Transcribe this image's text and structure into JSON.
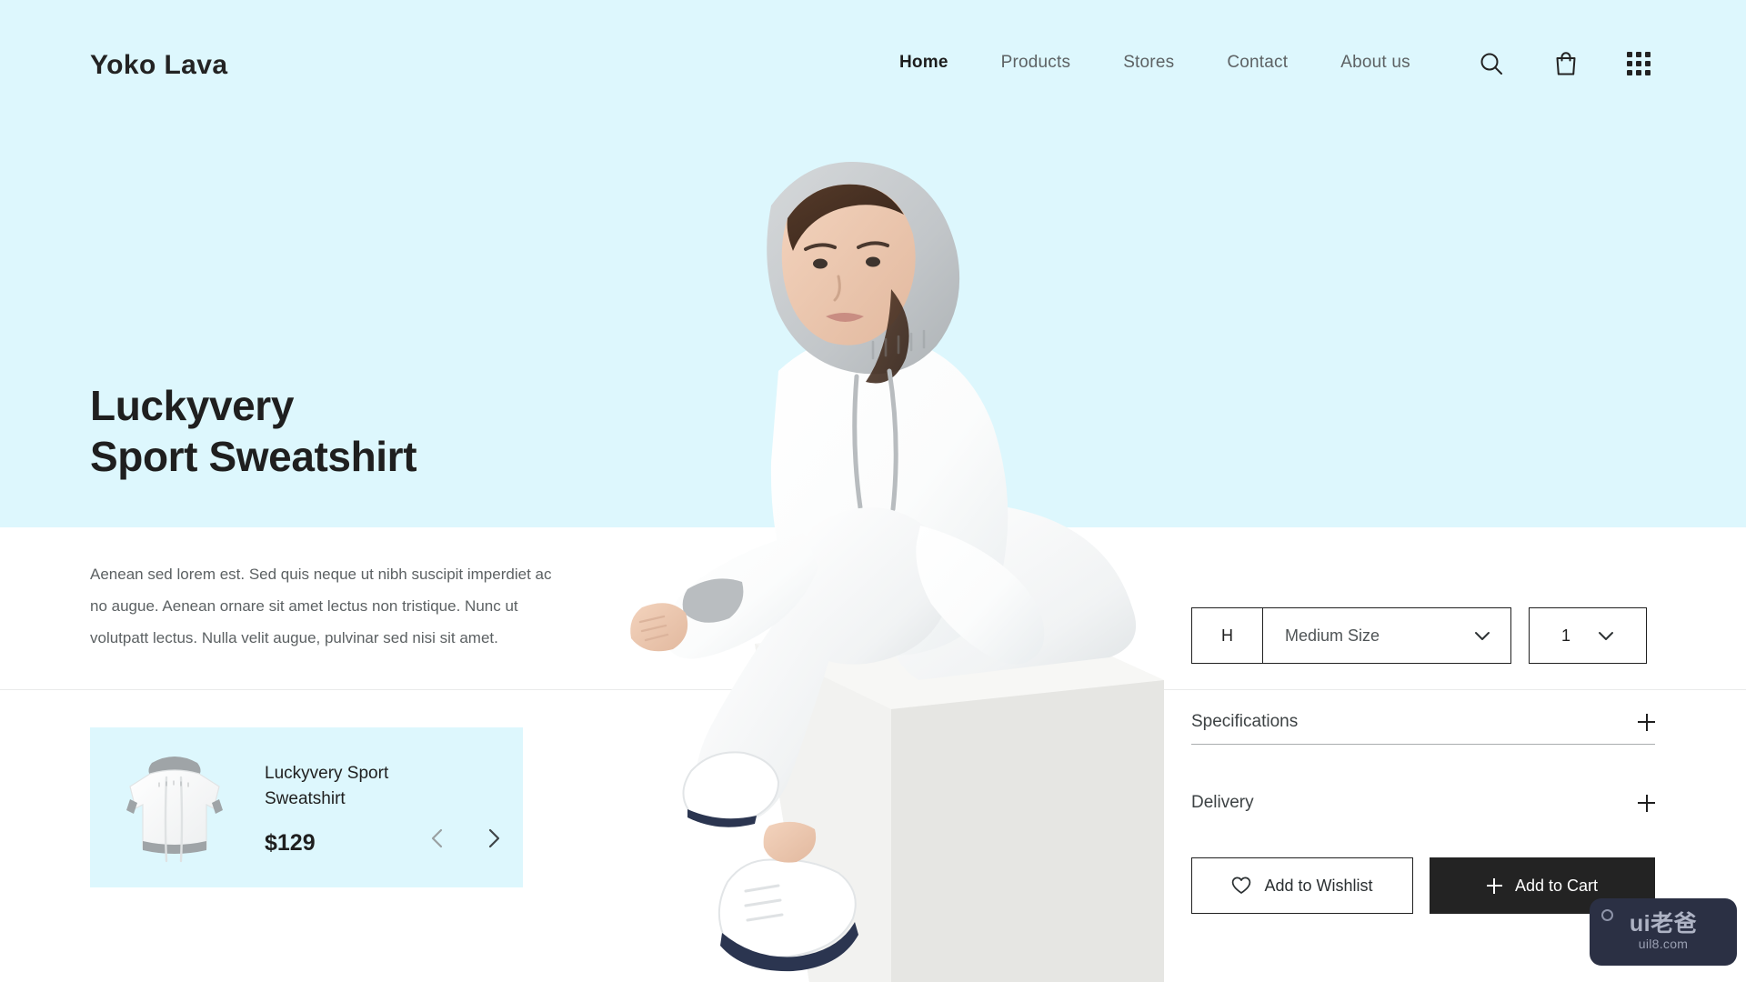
{
  "brand": {
    "name": "Yoko Lava"
  },
  "nav": {
    "items": [
      {
        "label": "Home",
        "active": true
      },
      {
        "label": "Products",
        "active": false
      },
      {
        "label": "Stores",
        "active": false
      },
      {
        "label": "Contact",
        "active": false
      },
      {
        "label": "About us",
        "active": false
      }
    ],
    "icons": [
      "search-icon",
      "shopping-bag-icon",
      "grid-menu-icon"
    ]
  },
  "hero": {
    "title_line1": "Luckyvery",
    "title_line2": "Sport Sweatshirt",
    "description": "Aenean sed lorem est. Sed quis neque ut nibh suscipit imperdiet ac no augue. Aenean ornare sit amet lectus non tristique. Nunc ut volutpatt lectus. Nulla velit augue, pulvinar sed nisi sit amet.",
    "background_color": "#ddf7fd"
  },
  "product_card": {
    "title": "Luckyvery Sport Sweatshirt",
    "price": "$129",
    "prev_label": "‹",
    "next_label": "›",
    "background_color": "#ddf7fd"
  },
  "options": {
    "size_prefix": "H",
    "size_value": "Medium Size",
    "quantity_value": "1"
  },
  "accordions": [
    {
      "label": "Specifications",
      "expander": "+"
    },
    {
      "label": "Delivery",
      "expander": "+"
    }
  ],
  "actions": {
    "wishlist_label": "Add to Wishlist",
    "cart_label": "Add to Cart",
    "cart_background": "#232323"
  },
  "watermark": {
    "main": "ui老爸",
    "sub": "uil8.com",
    "background": "#2b3044"
  }
}
